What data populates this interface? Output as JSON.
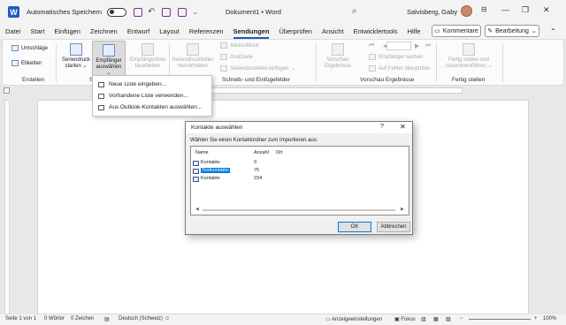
{
  "titlebar": {
    "autosave_label": "Automatisches Speichern",
    "doc_title": "Dokument1  •  Word",
    "user_name": "Salvisberg, Gaby",
    "minimize": "—",
    "restore": "❐",
    "close": "✕"
  },
  "tabs": [
    "Datei",
    "Start",
    "Einfügen",
    "Zeichnen",
    "Entwurf",
    "Layout",
    "Referenzen",
    "Sendungen",
    "Überprüfen",
    "Ansicht",
    "Entwicklertools",
    "Hilfe"
  ],
  "active_tab": "Sendungen",
  "header_buttons": {
    "comments": "Kommentare",
    "editing": "Bearbeitung"
  },
  "ribbon": {
    "envelopes": "Umschläge",
    "labels": "Etiketten",
    "start_merge_1": "Seriendruck",
    "start_merge_2": "starten",
    "select_recipients_1": "Empfänger",
    "select_recipients_2": "auswählen",
    "edit_list_1": "Empfängerliste",
    "edit_list_2": "bearbeiten",
    "highlight_1": "Seriendruckfelder",
    "highlight_2": "hervorheben",
    "address_block": "Adressblock",
    "greeting": "Grußzeile",
    "insert_field": "Seriendruckfeld einfügen",
    "preview_1": "Vorschau",
    "preview_2": "Ergebnisse",
    "find_recipient": "Empfänger suchen",
    "check_errors": "Auf Fehler überprüfen",
    "finish_1": "Fertig stellen und",
    "finish_2": "zusammenführen",
    "group_create": "Erstellen",
    "group_start": "S",
    "group_write": "Schreib- und Einfügefelder",
    "group_preview": "Vorschau Ergebnisse",
    "group_finish": "Fertig stellen"
  },
  "menu": {
    "items": [
      "Neue Liste eingeben...",
      "Vorhandene Liste verwenden...",
      "Aus Outlook-Kontakten auswählen..."
    ]
  },
  "dialog": {
    "title": "Kontakte auswählen",
    "help": "?",
    "close": "✕",
    "instruction": "Wählen Sie einen Kontaktordner zum Importieren aus:",
    "columns": [
      "Name",
      "Anzahl",
      "Ort"
    ],
    "rows": [
      {
        "name": "Kontakte",
        "count": "0",
        "selected": false
      },
      {
        "name": "Testkontakte",
        "count": "75",
        "selected": true
      },
      {
        "name": "Kontakte",
        "count": "234",
        "selected": false
      }
    ],
    "ok": "OK",
    "cancel": "Abbrechen"
  },
  "statusbar": {
    "page": "Seite 1 von 1",
    "words": "0 Wörter",
    "chars": "0 Zeichen",
    "language": "Deutsch (Schweiz)",
    "display_settings": "Anzeigeeinstellungen",
    "focus": "Fokus",
    "zoom": "100%"
  },
  "colors": {
    "accent": "#1e5bbf",
    "selection": "#0078d7"
  }
}
